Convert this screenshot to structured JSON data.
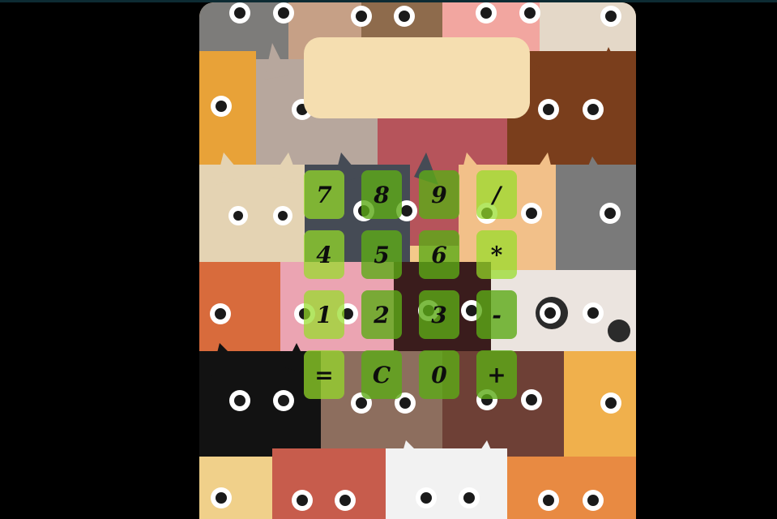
{
  "display": {
    "value": ""
  },
  "keypad": {
    "rows": [
      [
        "7",
        "8",
        "9",
        "/"
      ],
      [
        "4",
        "5",
        "6",
        "*"
      ],
      [
        "1",
        "2",
        "3",
        "-"
      ],
      [
        "=",
        "C",
        "0",
        "+"
      ]
    ]
  },
  "colors": {
    "display_bg": "#f5deb0",
    "key_light": "#96dc28",
    "key_dark": "#5caa16",
    "page_bg": "#000000"
  }
}
